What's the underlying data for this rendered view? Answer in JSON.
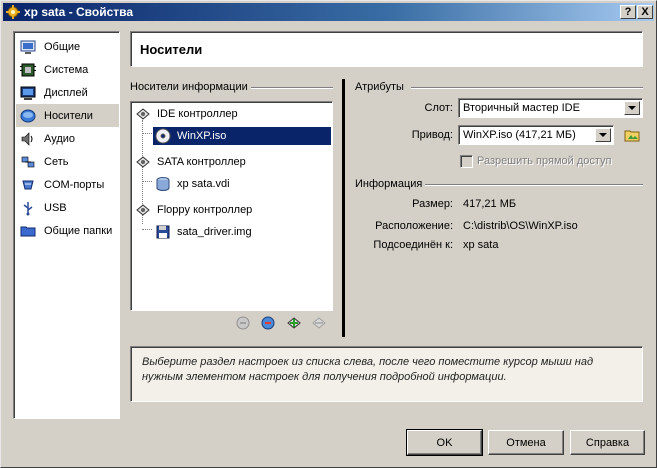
{
  "window": {
    "title": "xp sata - Свойства",
    "help_button": "?",
    "close_button": "X"
  },
  "sidebar": {
    "items": [
      {
        "label": "Общие",
        "icon": "general-icon"
      },
      {
        "label": "Система",
        "icon": "system-icon"
      },
      {
        "label": "Дисплей",
        "icon": "display-icon"
      },
      {
        "label": "Носители",
        "icon": "storage-icon",
        "selected": true
      },
      {
        "label": "Аудио",
        "icon": "audio-icon"
      },
      {
        "label": "Сеть",
        "icon": "network-icon"
      },
      {
        "label": "COM-порты",
        "icon": "com-port-icon"
      },
      {
        "label": "USB",
        "icon": "usb-icon"
      },
      {
        "label": "Общие папки",
        "icon": "shared-folder-icon"
      }
    ]
  },
  "header": {
    "title": "Носители"
  },
  "storage_tree": {
    "group_label": "Носители информации",
    "controllers": [
      {
        "label": "IDE контроллер",
        "attachments": [
          {
            "label": "WinXP.iso",
            "selected": true
          }
        ]
      },
      {
        "label": "SATA контроллер",
        "attachments": [
          {
            "label": "xp sata.vdi"
          }
        ]
      },
      {
        "label": "Floppy контроллер",
        "attachments": [
          {
            "label": "sata_driver.img"
          }
        ]
      }
    ]
  },
  "attributes": {
    "group_label": "Атрибуты",
    "slot_label": "Слот:",
    "slot_value": "Вторичный мастер IDE",
    "drive_label": "Привод:",
    "drive_value": "WinXP.iso (417,21 МБ)",
    "passthrough_label": "Разрешить прямой доступ"
  },
  "information": {
    "group_label": "Информация",
    "rows": [
      {
        "label": "Размер:",
        "value": "417,21 МБ"
      },
      {
        "label": "Расположение:",
        "value": "C:\\distrib\\OS\\WinXP.iso"
      },
      {
        "label": "Подсоединён к:",
        "value": "xp sata"
      }
    ]
  },
  "description": "Выберите раздел настроек из списка слева, после чего поместите курсор мыши над нужным элементом настроек для получения подробной информации.",
  "buttons": {
    "ok": "OK",
    "cancel": "Отмена",
    "help": "Справка"
  },
  "colors": {
    "title_start": "#0a246a",
    "title_end": "#a6caf0",
    "selection": "#0a246a",
    "face": "#d4d0c8"
  }
}
